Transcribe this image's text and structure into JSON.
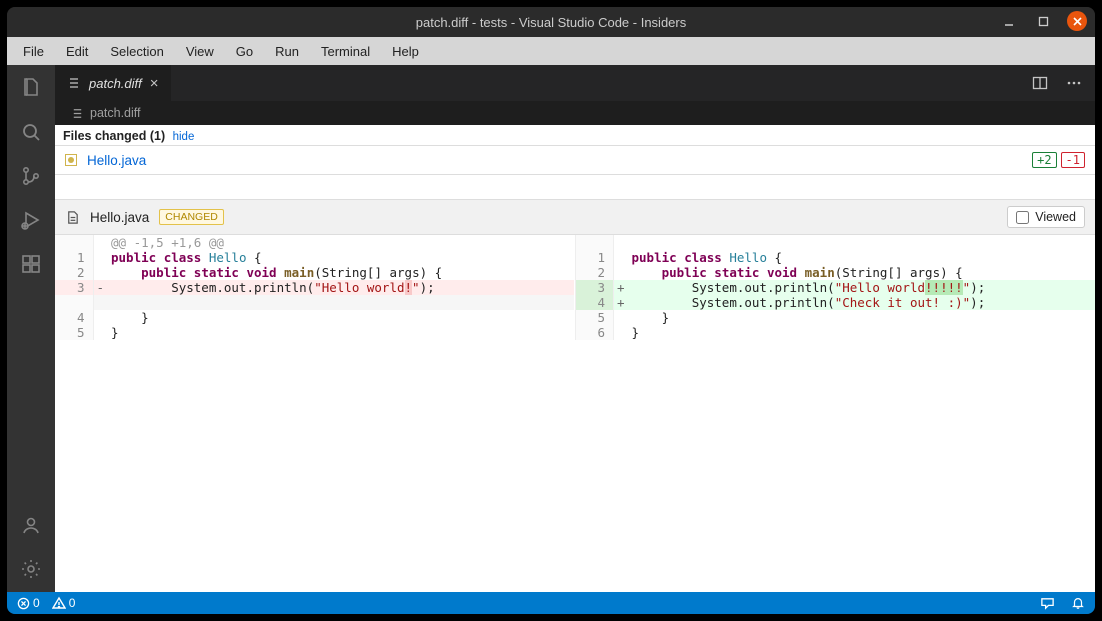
{
  "window": {
    "title": "patch.diff - tests - Visual Studio Code - Insiders"
  },
  "menu": [
    "File",
    "Edit",
    "Selection",
    "View",
    "Go",
    "Run",
    "Terminal",
    "Help"
  ],
  "activity": {
    "icons": [
      "files",
      "search",
      "scm",
      "debug",
      "extensions"
    ],
    "bottom": [
      "account",
      "settings"
    ]
  },
  "tab": {
    "label": "patch.diff"
  },
  "breadcrumb": {
    "label": "patch.diff"
  },
  "files_changed": {
    "label": "Files changed (1)",
    "hide": "hide"
  },
  "summary": {
    "filename": "Hello.java",
    "additions": "+2",
    "deletions": "-1"
  },
  "filehdr": {
    "filename": "Hello.java",
    "badge": "CHANGED",
    "viewed": "Viewed"
  },
  "hunk": "@@ -1,5 +1,6 @@",
  "left": {
    "rows": [
      {
        "n": "1",
        "sign": " ",
        "html": "<span class='kw'>public</span> <span class='kw'>class</span> <span class='cls'>Hello</span> {"
      },
      {
        "n": "2",
        "sign": " ",
        "html": "    <span class='kw'>public</span> <span class='kw'>static</span> <span class='kw'>void</span> <span class='fn'>main</span>(String[] args) {"
      },
      {
        "n": "3",
        "sign": "-",
        "cls": "del",
        "html": "        System.out.println(<span class='str'>\"Hello world<span class='hl-del'>!</span>\"</span>);"
      },
      {
        "n": "",
        "sign": " ",
        "cls": "ctx-gap",
        "html": " "
      },
      {
        "n": "4",
        "sign": " ",
        "html": "    }"
      },
      {
        "n": "5",
        "sign": " ",
        "html": "}"
      }
    ]
  },
  "right": {
    "rows": [
      {
        "n": "1",
        "sign": " ",
        "html": "<span class='kw'>public</span> <span class='kw'>class</span> <span class='cls'>Hello</span> {"
      },
      {
        "n": "2",
        "sign": " ",
        "html": "    <span class='kw'>public</span> <span class='kw'>static</span> <span class='kw'>void</span> <span class='fn'>main</span>(String[] args) {"
      },
      {
        "n": "3",
        "sign": "+",
        "cls": "add",
        "html": "        System.out.println(<span class='str'>\"Hello world<span class='hl-add'>!!!!!</span>\"</span>);"
      },
      {
        "n": "4",
        "sign": "+",
        "cls": "add",
        "html": "        System.out.println(<span class='str'>\"Check it out! :)\"</span>);"
      },
      {
        "n": "5",
        "sign": " ",
        "html": "    }"
      },
      {
        "n": "6",
        "sign": " ",
        "html": "}"
      }
    ]
  },
  "status": {
    "errors": "0",
    "warnings": "0"
  }
}
